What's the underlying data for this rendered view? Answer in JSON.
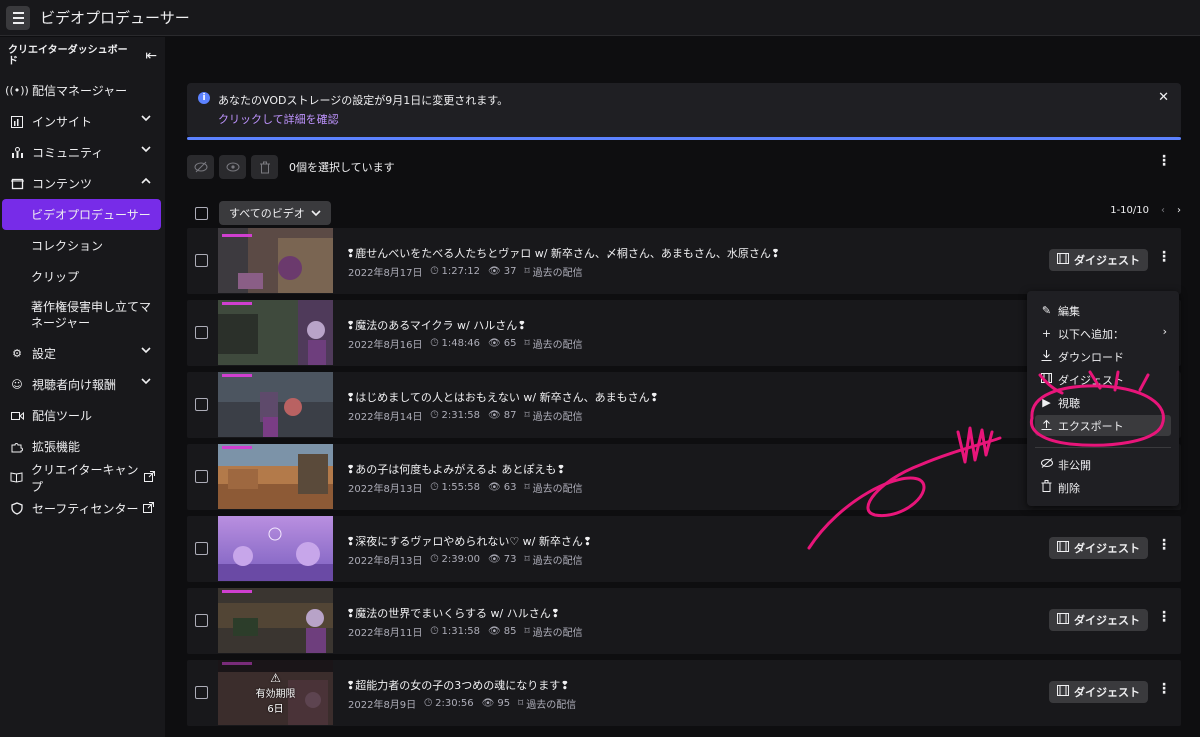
{
  "app": {
    "title": "ビデオプロデューサー"
  },
  "sidebar": {
    "header": "クリエイターダッシュボード",
    "items": [
      {
        "label": "配信マネージャー",
        "icon": "broadcast-icon"
      },
      {
        "label": "インサイト",
        "icon": "chart-icon"
      },
      {
        "label": "コミュニティ",
        "icon": "community-icon"
      },
      {
        "label": "コンテンツ",
        "icon": "content-icon"
      },
      {
        "label": "ビデオプロデューサー",
        "active": true
      },
      {
        "label": "コレクション"
      },
      {
        "label": "クリップ"
      },
      {
        "label": "著作権侵害申し立てマネージャー"
      },
      {
        "label": "設定",
        "icon": "gear-icon"
      },
      {
        "label": "視聴者向け報酬",
        "icon": "smile-icon"
      },
      {
        "label": "配信ツール",
        "icon": "camera-icon"
      },
      {
        "label": "拡張機能",
        "icon": "puzzle-icon"
      },
      {
        "label": "クリエイターキャンプ",
        "icon": "book-icon"
      },
      {
        "label": "セーフティセンター",
        "icon": "shield-icon"
      }
    ]
  },
  "notice": {
    "message": "あなたのVODストレージの設定が9月1日に変更されます。",
    "link": "クリックして詳細を確認"
  },
  "toolbar": {
    "selected": "0個を選択しています"
  },
  "filter": {
    "label": "すべてのビデオ",
    "range": "1-10/10"
  },
  "videos": [
    {
      "title": "❢鹿せんべいをたべる人たちとヴァロ w/ 新卒さん、〆桐さん、あまもさん、水原さん❢",
      "date": "2022年8月17日",
      "duration": "1:27:12",
      "views": "37",
      "type": "過去の配信",
      "digest": "ダイジェスト"
    },
    {
      "title": "❢魔法のあるマイクラ w/ ハルさん❢",
      "date": "2022年8月16日",
      "duration": "1:48:46",
      "views": "65",
      "type": "過去の配信",
      "digest": ""
    },
    {
      "title": "❢はじめましての人とはおもえない w/ 新卒さん、あまもさん❢",
      "date": "2022年8月14日",
      "duration": "2:31:58",
      "views": "87",
      "type": "過去の配信",
      "digest": ""
    },
    {
      "title": "❢あの子は何度もよみがえるよ あとぽえも❢",
      "date": "2022年8月13日",
      "duration": "1:55:58",
      "views": "63",
      "type": "過去の配信",
      "digest": ""
    },
    {
      "title": "❢深夜にするヴァロやめられない♡ w/ 新卒さん❢",
      "date": "2022年8月13日",
      "duration": "2:39:00",
      "views": "73",
      "type": "過去の配信",
      "digest": "ダイジェスト"
    },
    {
      "title": "❢魔法の世界でまいくらする w/ ハルさん❢",
      "date": "2022年8月11日",
      "duration": "1:31:58",
      "views": "85",
      "type": "過去の配信",
      "digest": "ダイジェスト"
    },
    {
      "title": "❢超能力者の女の子の3つめの魂になります❢",
      "date": "2022年8月9日",
      "duration": "2:30:56",
      "views": "95",
      "type": "過去の配信",
      "digest": "ダイジェスト",
      "expire_label": "有効期限",
      "expire_days": "6日"
    }
  ],
  "context_menu": {
    "items": [
      {
        "label": "編集",
        "icon": "pencil-icon"
      },
      {
        "label": "以下へ追加：",
        "icon": "plus-icon"
      },
      {
        "label": "ダウンロード",
        "icon": "download-icon"
      },
      {
        "label": "ダイジェスト",
        "icon": "film-icon"
      },
      {
        "label": "視聴",
        "icon": "play-icon"
      },
      {
        "label": "エクスポート",
        "icon": "upload-icon",
        "highlighted": true
      },
      {
        "label": "非公開",
        "icon": "eye-off-icon"
      },
      {
        "label": "削除",
        "icon": "trash-icon"
      }
    ]
  },
  "colors": {
    "accent": "#772ce8",
    "link": "#bf94ff",
    "info": "#5c82ff",
    "scribble": "#e8157a"
  }
}
